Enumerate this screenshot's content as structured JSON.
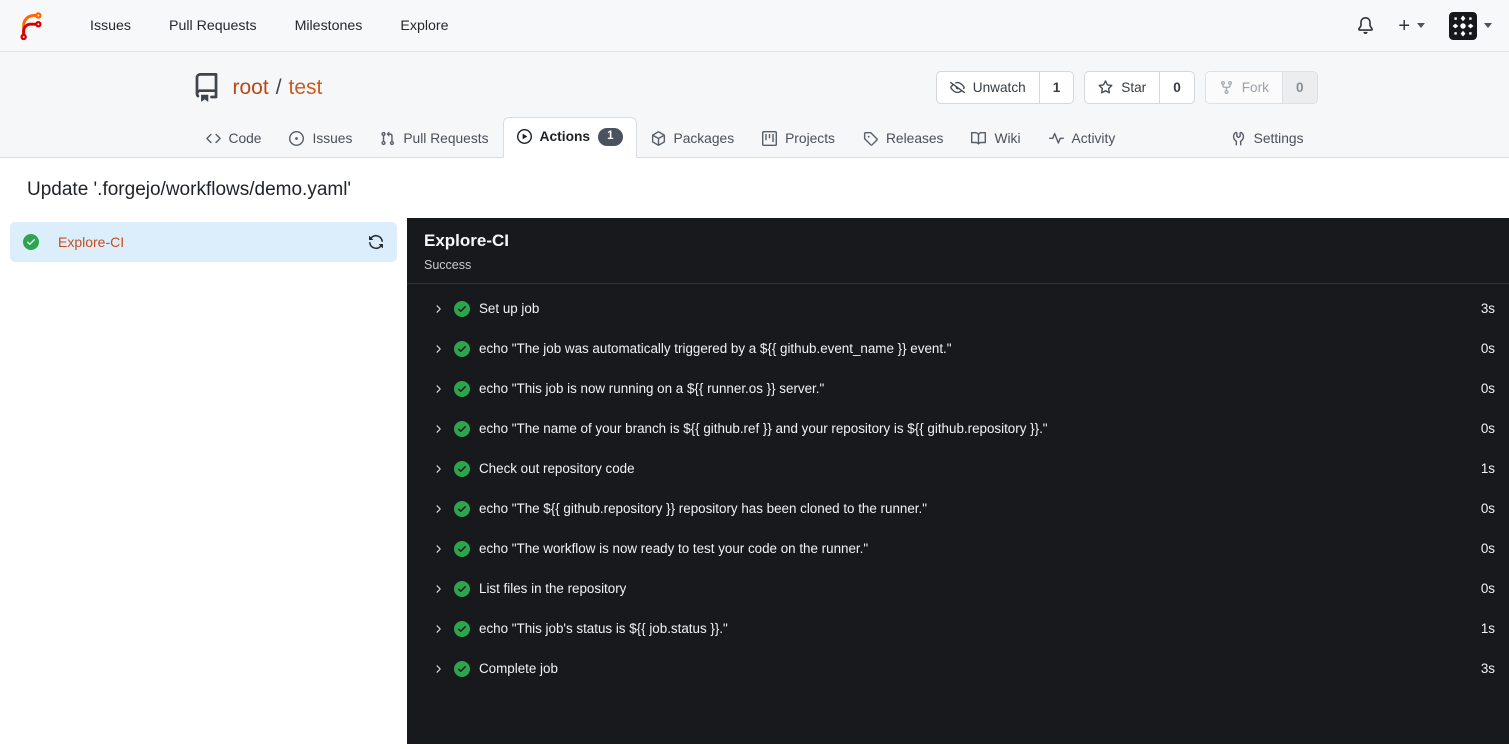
{
  "topnav": {
    "items": [
      {
        "label": "Issues"
      },
      {
        "label": "Pull Requests"
      },
      {
        "label": "Milestones"
      },
      {
        "label": "Explore"
      }
    ],
    "plus_label": "+"
  },
  "repo": {
    "owner": "root",
    "separator": "/",
    "name": "test",
    "actions": {
      "unwatch": {
        "label": "Unwatch",
        "count": "1"
      },
      "star": {
        "label": "Star",
        "count": "0"
      },
      "fork": {
        "label": "Fork",
        "count": "0",
        "disabled": true
      }
    }
  },
  "tabs": [
    {
      "label": "Code"
    },
    {
      "label": "Issues"
    },
    {
      "label": "Pull Requests"
    },
    {
      "label": "Actions",
      "badge": "1",
      "active": true
    },
    {
      "label": "Packages"
    },
    {
      "label": "Projects"
    },
    {
      "label": "Releases"
    },
    {
      "label": "Wiki"
    },
    {
      "label": "Activity"
    },
    {
      "label": "Settings"
    }
  ],
  "run": {
    "title": "Update '.forgejo/workflows/demo.yaml'",
    "job": {
      "name": "Explore-CI",
      "status": "success"
    },
    "panel": {
      "title": "Explore-CI",
      "status_text": "Success"
    },
    "steps": [
      {
        "name": "Set up job",
        "duration": "3s"
      },
      {
        "name": "echo \"The job was automatically triggered by a ${{ github.event_name }} event.\"",
        "duration": "0s"
      },
      {
        "name": "echo \"This job is now running on a ${{ runner.os }} server.\"",
        "duration": "0s"
      },
      {
        "name": "echo \"The name of your branch is ${{ github.ref }} and your repository is ${{ github.repository }}.\"",
        "duration": "0s"
      },
      {
        "name": "Check out repository code",
        "duration": "1s"
      },
      {
        "name": "echo \"The ${{ github.repository }} repository has been cloned to the runner.\"",
        "duration": "0s"
      },
      {
        "name": "echo \"The workflow is now ready to test your code on the runner.\"",
        "duration": "0s"
      },
      {
        "name": "List files in the repository",
        "duration": "0s"
      },
      {
        "name": "echo \"This job's status is ${{ job.status }}.\"",
        "duration": "1s"
      },
      {
        "name": "Complete job",
        "duration": "3s"
      }
    ]
  },
  "colors": {
    "accent_orange": "#c8501e",
    "success_green": "#2da44e",
    "panel_bg": "#17191c",
    "selected_job_bg": "#dceefb",
    "badge_bg": "#49525e"
  }
}
